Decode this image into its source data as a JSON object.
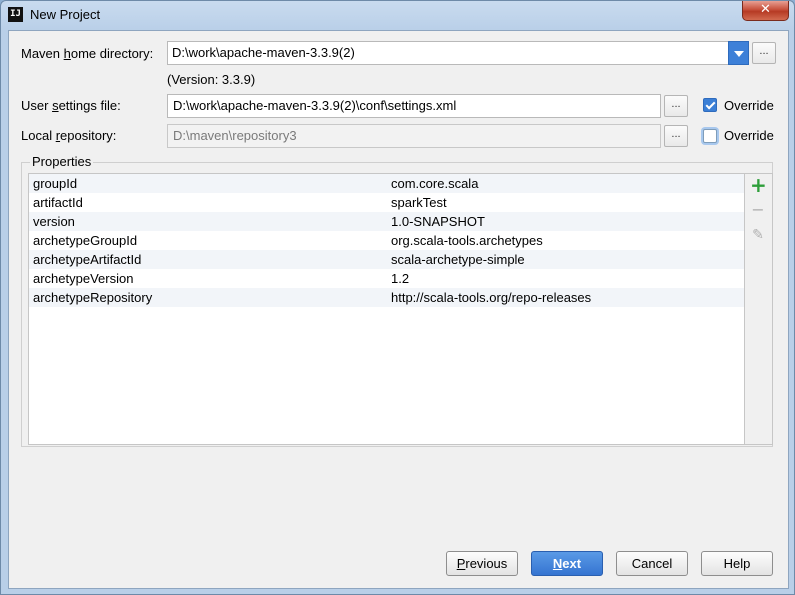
{
  "window": {
    "title": "New Project",
    "close_symbol": "✕"
  },
  "maven_home": {
    "label_pre": "Maven ",
    "label_mnemonic": "h",
    "label_post": "ome directory:",
    "value": "D:\\work\\apache-maven-3.3.9(2)",
    "version": "(Version: 3.3.9)"
  },
  "user_settings": {
    "label_pre": "User ",
    "label_mnemonic": "s",
    "label_post": "ettings file:",
    "value": "D:\\work\\apache-maven-3.3.9(2)\\conf\\settings.xml",
    "override_label": "Override",
    "override_checked": true
  },
  "local_repo": {
    "label_pre": "Local ",
    "label_mnemonic": "r",
    "label_post": "epository:",
    "value": "D:\\maven\\repository3",
    "override_label": "Override",
    "override_checked": false
  },
  "browse_label": "...",
  "properties": {
    "title": "Properties",
    "rows": [
      {
        "key": "groupId",
        "value": "com.core.scala"
      },
      {
        "key": "artifactId",
        "value": "sparkTest"
      },
      {
        "key": "version",
        "value": "1.0-SNAPSHOT"
      },
      {
        "key": "archetypeGroupId",
        "value": "org.scala-tools.archetypes"
      },
      {
        "key": "archetypeArtifactId",
        "value": "scala-archetype-simple"
      },
      {
        "key": "archetypeVersion",
        "value": "1.2"
      },
      {
        "key": "archetypeRepository",
        "value": "http://scala-tools.org/repo-releases"
      }
    ],
    "toolbar": {
      "add_symbol": "+",
      "remove_symbol": "−",
      "edit_symbol": "✎"
    }
  },
  "buttons": {
    "previous_mnemonic": "P",
    "previous_rest": "revious",
    "next_mnemonic": "N",
    "next_rest": "ext",
    "cancel": "Cancel",
    "help": "Help"
  },
  "colors": {
    "accent": "#3d80d8",
    "add_icon": "#2e9e3a",
    "disabled_icon": "#b0b0b0"
  }
}
